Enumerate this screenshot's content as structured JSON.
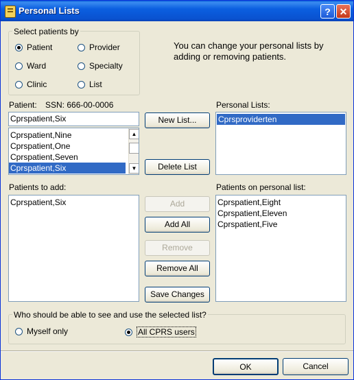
{
  "window": {
    "title": "Personal Lists"
  },
  "select_group": {
    "label": "Select patients by",
    "options": [
      "Patient",
      "Provider",
      "Ward",
      "Specialty",
      "Clinic",
      "List"
    ]
  },
  "info_text": "You can change your personal lists by adding or removing patients.",
  "patient": {
    "label": "Patient:",
    "ssn": "SSN: 666-00-0006",
    "input_value": "Cprspatient,Six",
    "list_items": [
      "Cprspatient,Nine",
      "Cprspatient,One",
      "Cprspatient,Seven",
      "Cprspatient,Six"
    ]
  },
  "personal_lists": {
    "label": "Personal Lists:",
    "items": [
      "Cprsproviderten"
    ]
  },
  "patients_to_add": {
    "label": "Patients to add:",
    "items": [
      "Cprspatient,Six"
    ]
  },
  "patients_on_list": {
    "label": "Patients on personal list:",
    "items": [
      "Cprspatient,Eight",
      "Cprspatient,Eleven",
      "Cprspatient,Five"
    ]
  },
  "buttons": {
    "new_list": "New List...",
    "delete_list": "Delete List",
    "add": "Add",
    "add_all": "Add All",
    "remove": "Remove",
    "remove_all": "Remove All",
    "save_changes": "Save Changes",
    "ok": "OK",
    "cancel": "Cancel"
  },
  "visibility_group": {
    "label": "Who should be able to see and use the selected list?",
    "myself": "Myself only",
    "all_users": "All CPRS users"
  }
}
